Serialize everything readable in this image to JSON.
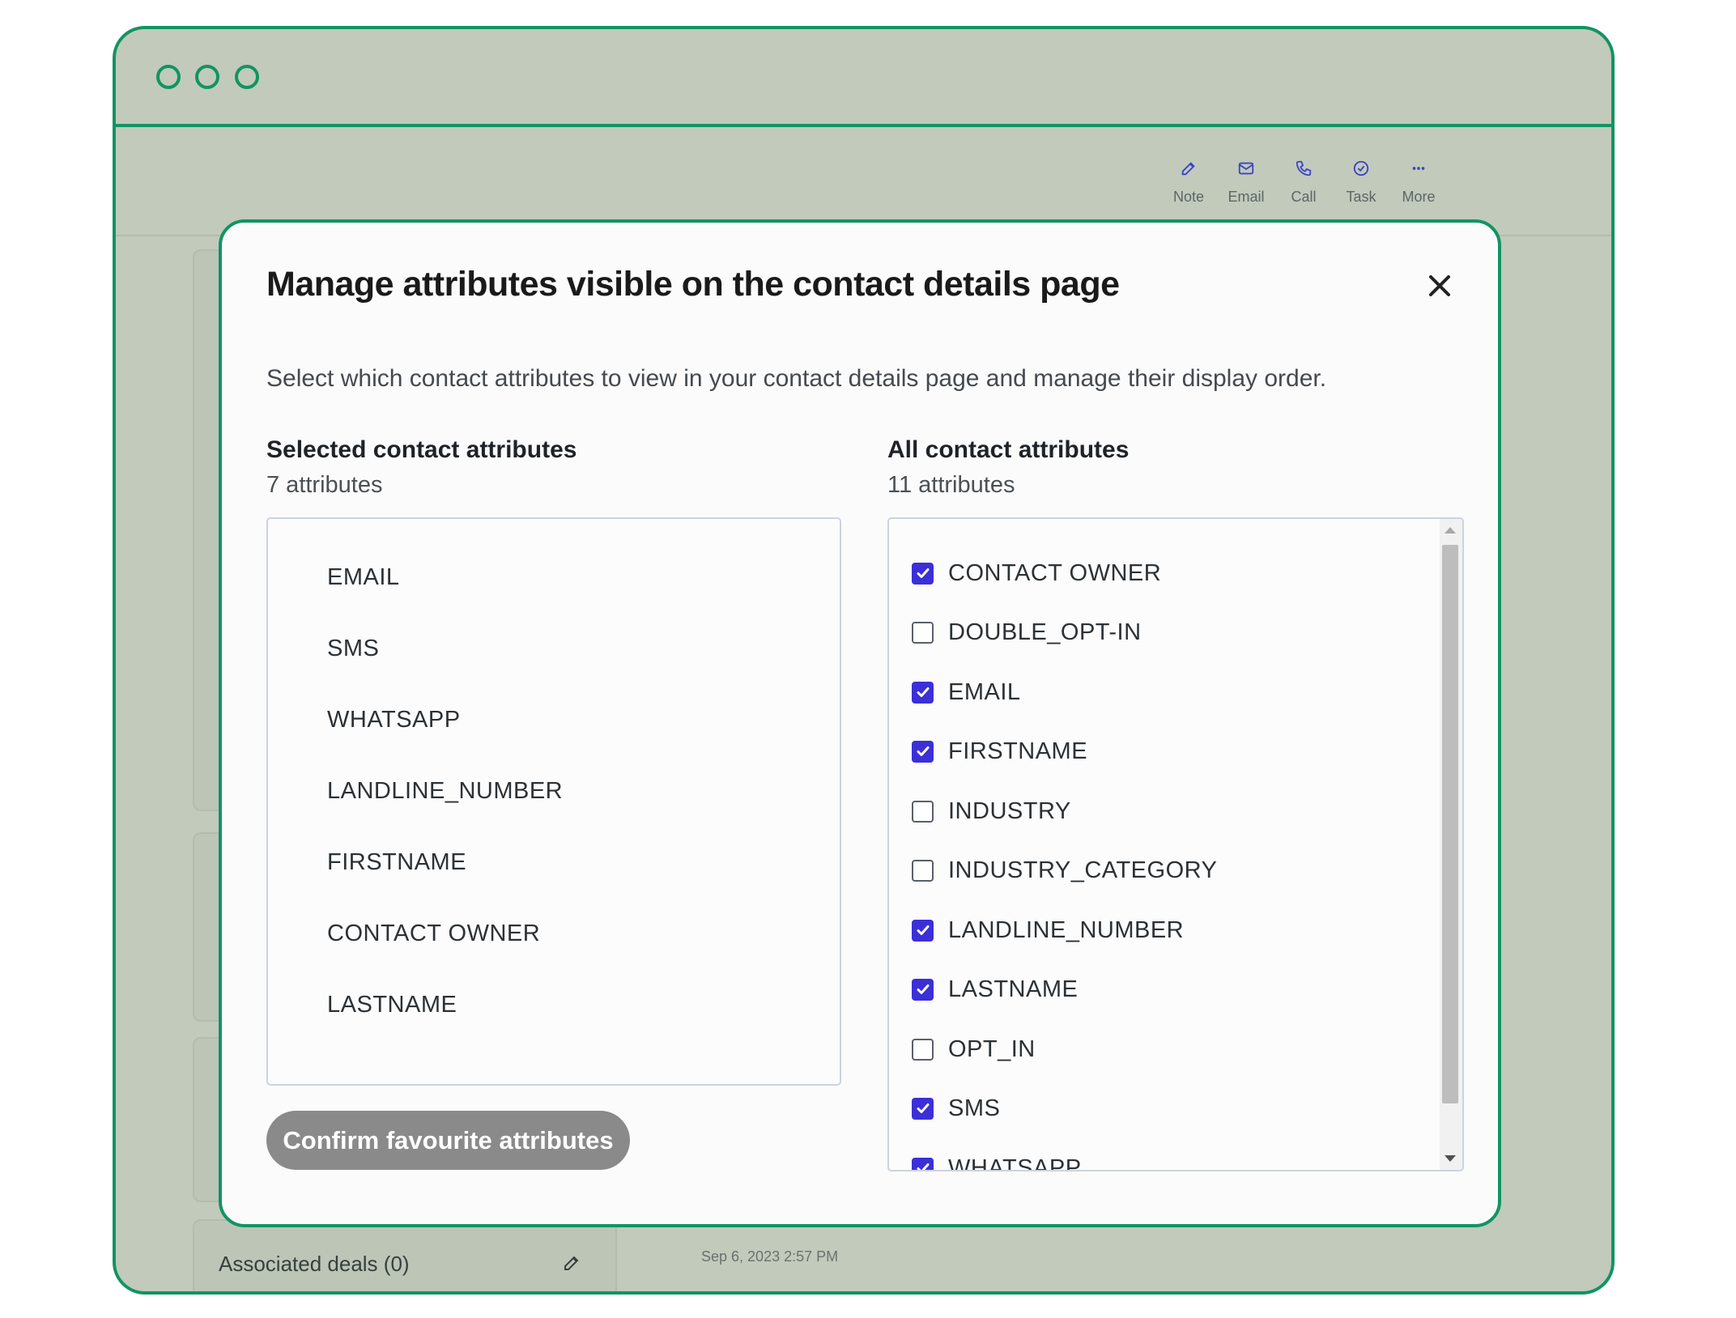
{
  "toolbar": {
    "actions": [
      {
        "label": "Note",
        "icon": "note-icon"
      },
      {
        "label": "Email",
        "icon": "email-icon"
      },
      {
        "label": "Call",
        "icon": "call-icon"
      },
      {
        "label": "Task",
        "icon": "task-icon"
      },
      {
        "label": "More",
        "icon": "more-icon"
      }
    ]
  },
  "background": {
    "associated_deals": "Associated deals (0)",
    "timestamp": "Sep 6, 2023 2:57 PM"
  },
  "modal": {
    "title": "Manage attributes visible on the contact details page",
    "description": "Select which contact attributes to view in your contact details page and manage their display order.",
    "selected": {
      "heading": "Selected contact attributes",
      "count": "7 attributes",
      "items": [
        "EMAIL",
        "SMS",
        "WHATSAPP",
        "LANDLINE_NUMBER",
        "FIRSTNAME",
        "CONTACT OWNER",
        "LASTNAME"
      ]
    },
    "all": {
      "heading": "All contact attributes",
      "count": "11 attributes",
      "items": [
        {
          "label": "CONTACT OWNER",
          "checked": true
        },
        {
          "label": "DOUBLE_OPT-IN",
          "checked": false
        },
        {
          "label": "EMAIL",
          "checked": true
        },
        {
          "label": "FIRSTNAME",
          "checked": true
        },
        {
          "label": "INDUSTRY",
          "checked": false
        },
        {
          "label": "INDUSTRY_CATEGORY",
          "checked": false
        },
        {
          "label": "LANDLINE_NUMBER",
          "checked": true
        },
        {
          "label": "LASTNAME",
          "checked": true
        },
        {
          "label": "OPT_IN",
          "checked": false
        },
        {
          "label": "SMS",
          "checked": true
        },
        {
          "label": "WHATSAPP",
          "checked": true
        }
      ]
    },
    "confirm_label": "Confirm favourite attributes"
  },
  "colors": {
    "frame_accent": "#129462",
    "checkbox_checked": "#3b2fd8",
    "button_disabled": "#8a8a8a"
  }
}
